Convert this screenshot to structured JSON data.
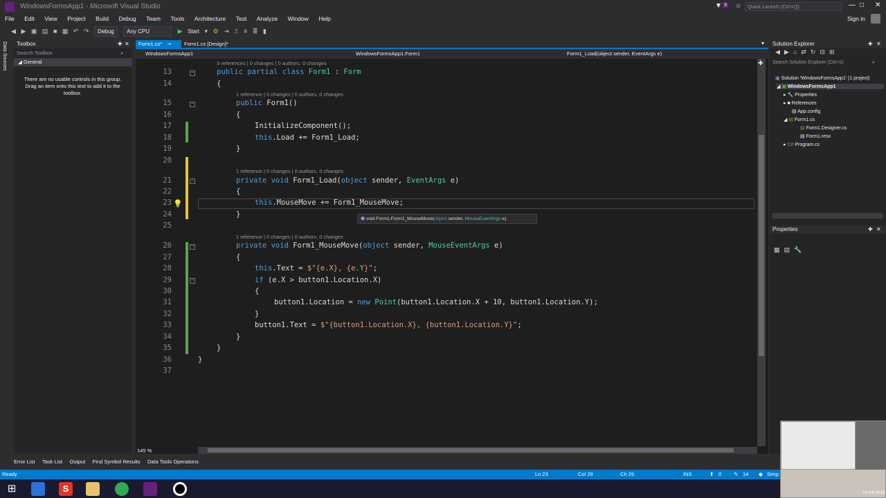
{
  "window": {
    "title": "WindowsFormsApp1 - Microsoft Visual Studio",
    "quick_launch": "Quick Launch (Ctrl+Q)",
    "notif_count": "3",
    "sign_in": "Sign in"
  },
  "menu": [
    "File",
    "Edit",
    "View",
    "Project",
    "Build",
    "Debug",
    "Team",
    "Tools",
    "Architecture",
    "Test",
    "Analyze",
    "Window",
    "Help"
  ],
  "toolbar": {
    "config": "Debug",
    "platform": "Any CPU",
    "start": "Start"
  },
  "toolbox": {
    "title": "Toolbox",
    "search_placeholder": "Search Toolbox",
    "group": "General",
    "empty_msg": "There are no usable controls in this group. Drag an item onto this text to add it to the toolbox."
  },
  "sidestrip_label": "Data Sources",
  "tabs": [
    {
      "label": "Form1.cs*",
      "active": true
    },
    {
      "label": "Form1.cs [Design]*",
      "active": false
    }
  ],
  "navbar": {
    "project": "WindowsFormsApp1",
    "class": "WindowsFormsApp1.Form1",
    "member": "Form1_Load(object sender, EventArgs e)"
  },
  "codelens": [
    "3 references | 0 changes | 0 authors, 0 changes",
    "1 reference | 0 changes | 0 authors, 0 changes",
    "1 reference | 0 changes | 0 authors, 0 changes",
    "1 reference | 0 changes | 0 authors, 0 changes"
  ],
  "line_numbers": [
    "13",
    "14",
    "15",
    "16",
    "17",
    "18",
    "19",
    "20",
    "21",
    "22",
    "23",
    "24",
    "25",
    "26",
    "27",
    "28",
    "29",
    "30",
    "31",
    "32",
    "33",
    "34",
    "35",
    "36",
    "37"
  ],
  "code": {
    "l13": [
      "public partial class ",
      "Form1",
      " : ",
      "Form"
    ],
    "l14": "{",
    "l15": [
      "public ",
      "Form1()"
    ],
    "l16": "{",
    "l17": "InitializeComponent();",
    "l18": [
      "this",
      ".Load += Form1_Load;"
    ],
    "l19": "}",
    "l21": [
      "private void ",
      "Form1_Load(",
      "object",
      " sender, ",
      "EventArgs",
      " e)"
    ],
    "l22": "{",
    "l23": [
      "this",
      ".MouseMove += Form1_MouseMove;"
    ],
    "l24": "}",
    "l26": [
      "private void ",
      "Form1_MouseMove(",
      "object",
      " sender, ",
      "MouseEventArgs",
      " e)"
    ],
    "l27": "{",
    "l28": [
      "this",
      ".Text = ",
      "$\"{e.X}, {e.Y}\"",
      ";"
    ],
    "l29": [
      "if",
      " (e.X > button1.Location.X)"
    ],
    "l30": "{",
    "l31": [
      "button1.Location = ",
      "new ",
      "Point",
      "(button1.Location.X + 10, button1.Location.Y);"
    ],
    "l32": "}",
    "l33": [
      "button1.Text = ",
      "$\"{button1.Location.X}, {button1.Location.Y}\"",
      ";"
    ],
    "l34": "}",
    "l35": "}",
    "l36": "}"
  },
  "tooltip": [
    "void Form1.Form1_MouseMove(",
    "object",
    " sender, ",
    "MouseEventArgs",
    " e)"
  ],
  "zoom": "145 %",
  "solution_explorer": {
    "title": "Solution Explorer",
    "search_placeholder": "Search Solution Explorer (Ctrl+ü)",
    "items": [
      "Solution 'WindowsFormsApp1' (1 project)",
      "WindowsFormsApp1",
      "Properties",
      "References",
      "App.config",
      "Form1.cs",
      "Form1.Designer.cs",
      "Form1.resx",
      "Program.cs"
    ]
  },
  "properties": {
    "title": "Properties"
  },
  "bottom_tabs": [
    "Error List",
    "Task List",
    "Output",
    "Find Symbol Results",
    "Data Tools Operations"
  ],
  "status": {
    "ready": "Ready",
    "ln": "Ln 23",
    "col": "Col 29",
    "ch": "Ch 29",
    "ins": "INS",
    "up": "0",
    "edits": "14",
    "publish": "Simp"
  },
  "taskbar_date": "18.04.2019"
}
